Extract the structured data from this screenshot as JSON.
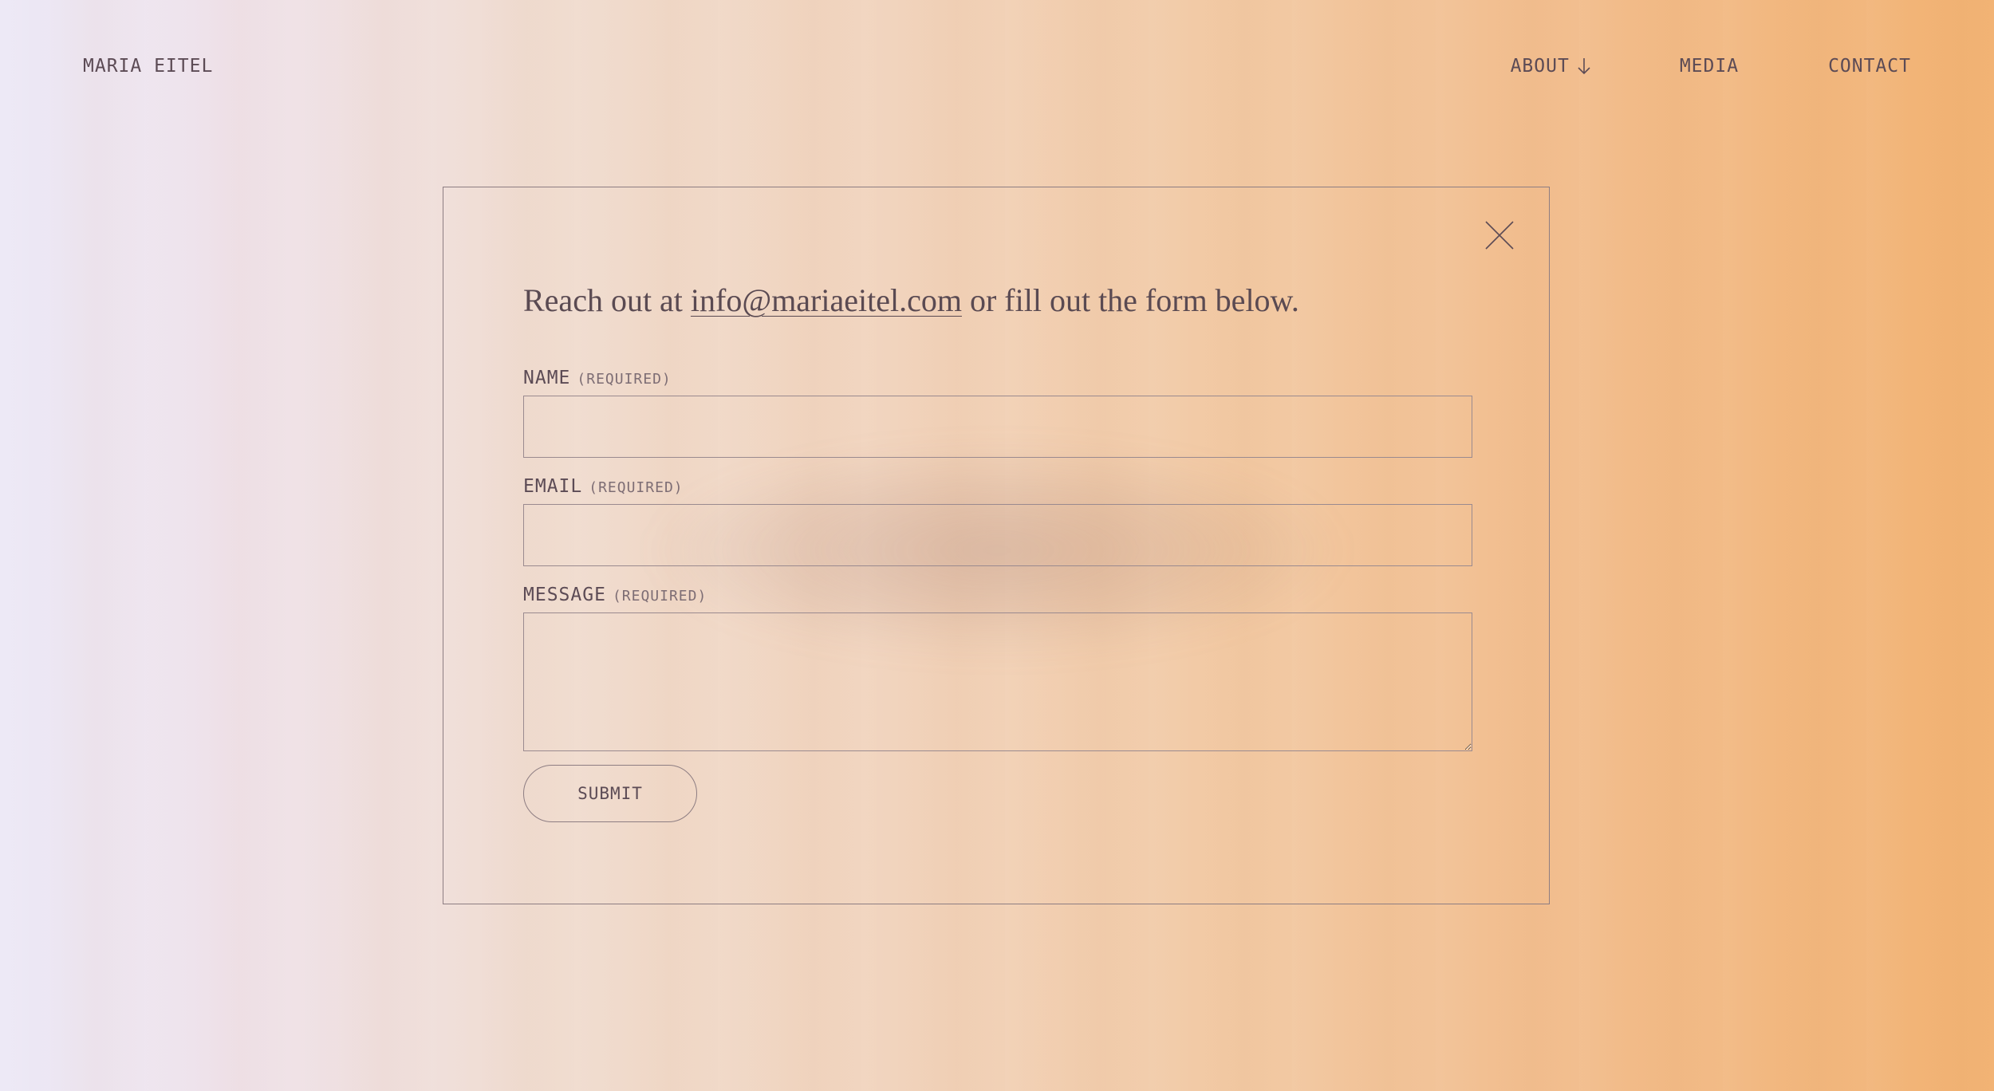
{
  "header": {
    "brand": "MARIA EITEL",
    "nav": [
      {
        "label": "ABOUT",
        "icon": "arrow-down-icon"
      },
      {
        "label": "MEDIA"
      },
      {
        "label": "CONTACT"
      }
    ]
  },
  "modal": {
    "close_icon": "close-icon",
    "intro_prefix": "Reach out at",
    "intro_email": "info@mariaeitel.com",
    "intro_suffix": "or fill out the form below.",
    "fields": {
      "name": {
        "label": "NAME",
        "required": "(REQUIRED)",
        "value": ""
      },
      "email": {
        "label": "EMAIL",
        "required": "(REQUIRED)",
        "value": ""
      },
      "message": {
        "label": "MESSAGE",
        "required": "(REQUIRED)",
        "value": ""
      }
    },
    "submit_label": "SUBMIT"
  },
  "colors": {
    "text": "#5a4a52",
    "border": "#8d7d82",
    "gradient_start": "#ece8f6",
    "gradient_end": "#f2b272"
  }
}
